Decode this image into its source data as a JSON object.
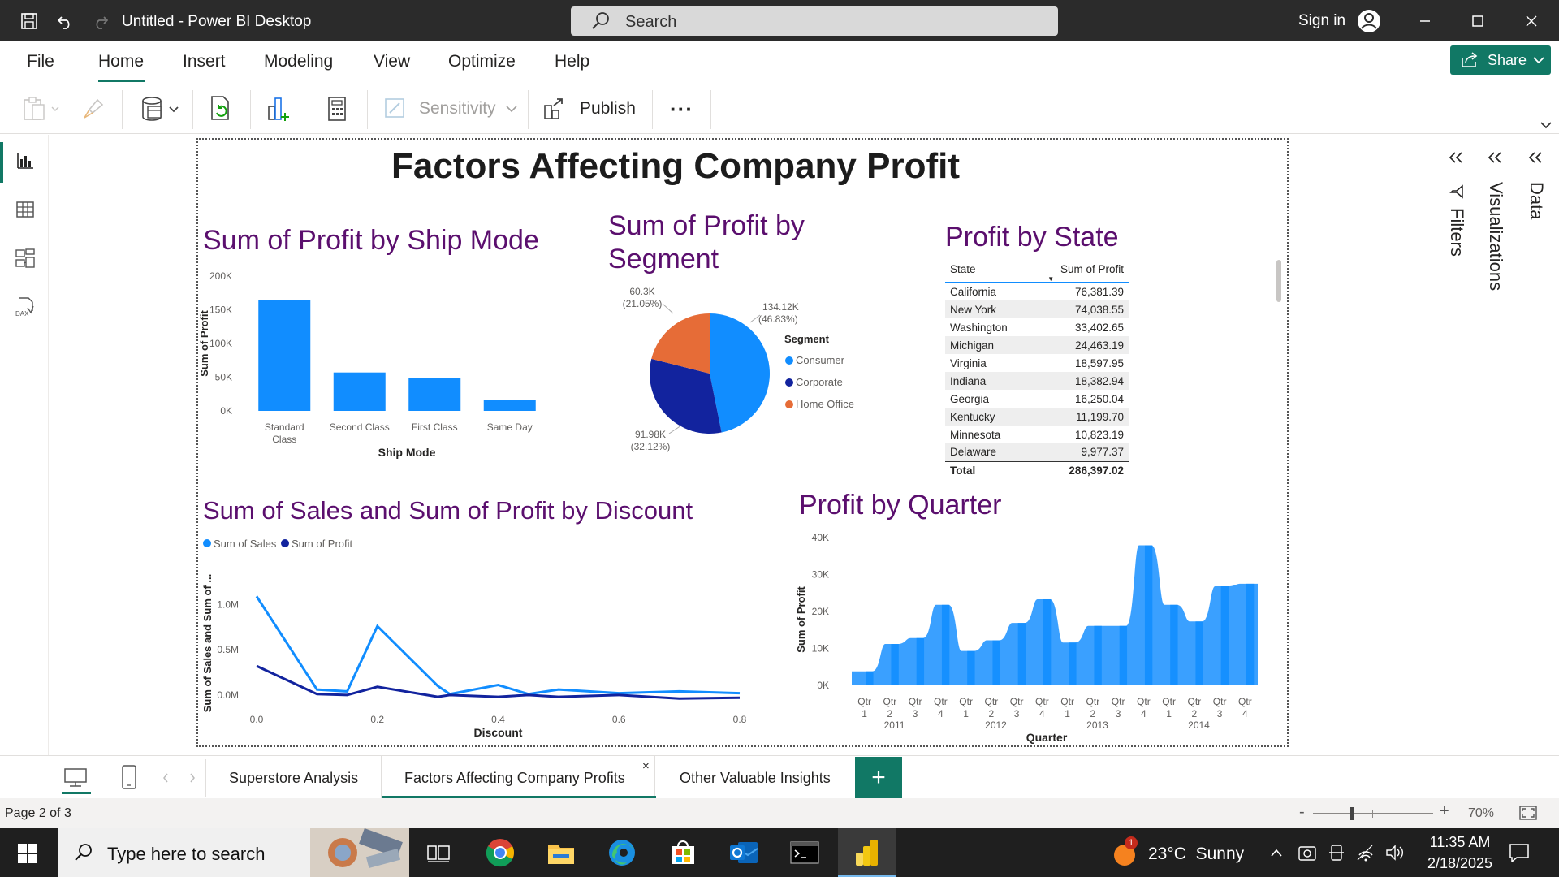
{
  "titlebar": {
    "title": "Untitled - Power BI Desktop",
    "search_placeholder": "Search",
    "signin": "Sign in"
  },
  "menu": {
    "items": [
      "File",
      "Home",
      "Insert",
      "Modeling",
      "View",
      "Optimize",
      "Help"
    ],
    "active": "Home",
    "share": "Share"
  },
  "toolbar": {
    "sensitivity": "Sensitivity",
    "publish": "Publish",
    "more": "···"
  },
  "report": {
    "title": "Factors Affecting Company Profit"
  },
  "visuals": {
    "ship_title": "Sum of Profit by Ship Mode",
    "segment_title": "Sum of Profit by Segment",
    "state_title": "Profit by State",
    "discount_title": "Sum of Sales and Sum of Profit by Discount",
    "quarter_title": "Profit by Quarter"
  },
  "state_table": {
    "headers": [
      "State",
      "Sum of Profit"
    ],
    "rows": [
      [
        "California",
        "76,381.39"
      ],
      [
        "New York",
        "74,038.55"
      ],
      [
        "Washington",
        "33,402.65"
      ],
      [
        "Michigan",
        "24,463.19"
      ],
      [
        "Virginia",
        "18,597.95"
      ],
      [
        "Indiana",
        "18,382.94"
      ],
      [
        "Georgia",
        "16,250.04"
      ],
      [
        "Kentucky",
        "11,199.70"
      ],
      [
        "Minnesota",
        "10,823.19"
      ],
      [
        "Delaware",
        "9,977.37"
      ]
    ],
    "total_label": "Total",
    "total_value": "286,397.02"
  },
  "chart_data": [
    {
      "type": "bar",
      "title": "Sum of Profit by Ship Mode",
      "xlabel": "Ship Mode",
      "ylabel": "Sum of Profit",
      "categories": [
        "Standard Class",
        "Second Class",
        "First Class",
        "Same Day"
      ],
      "values": [
        164000,
        57000,
        49000,
        15900
      ],
      "ylim": [
        0,
        200000
      ],
      "yticks": [
        "0K",
        "50K",
        "100K",
        "150K",
        "200K"
      ],
      "color": "#118dff"
    },
    {
      "type": "pie",
      "title": "Sum of Profit by Segment",
      "legend_title": "Segment",
      "categories": [
        "Consumer",
        "Corporate",
        "Home Office"
      ],
      "values": [
        134.12,
        91.98,
        60.3
      ],
      "value_labels": [
        "134.12K",
        "91.98K",
        "60.3K"
      ],
      "pct_labels": [
        "(46.83%)",
        "(32.12%)",
        "(21.05%)"
      ],
      "colors": [
        "#118dff",
        "#12239e",
        "#e66c37"
      ]
    },
    {
      "type": "line",
      "title": "Sum of Sales and Sum of Profit by Discount",
      "xlabel": "Discount",
      "ylabel": "Sum of Sales and Sum of ...",
      "x": [
        0.0,
        0.1,
        0.15,
        0.2,
        0.3,
        0.32,
        0.4,
        0.45,
        0.5,
        0.6,
        0.7,
        0.8
      ],
      "series": [
        {
          "name": "Sum of Sales",
          "color": "#118dff",
          "values": [
            1.09,
            0.06,
            0.04,
            0.76,
            0.1,
            0.01,
            0.11,
            0.01,
            0.06,
            0.02,
            0.04,
            0.02
          ]
        },
        {
          "name": "Sum of Profit",
          "color": "#12239e",
          "values": [
            0.32,
            0.01,
            0.0,
            0.09,
            -0.02,
            0.0,
            -0.02,
            0.0,
            -0.02,
            0.0,
            -0.04,
            -0.03
          ]
        }
      ],
      "ylim": [
        -0.1,
        1.2
      ],
      "yticks": [
        "0.0M",
        "0.5M",
        "1.0M"
      ],
      "xticks": [
        "0.0",
        "0.2",
        "0.4",
        "0.6",
        "0.8"
      ]
    },
    {
      "type": "area",
      "title": "Profit by Quarter",
      "xlabel": "Quarter",
      "ylabel": "Sum of Profit",
      "quarters": [
        "Qtr 1",
        "Qtr 2",
        "Qtr 3",
        "Qtr 4",
        "Qtr 1",
        "Qtr 2",
        "Qtr 3",
        "Qtr 4",
        "Qtr 1",
        "Qtr 2",
        "Qtr 3",
        "Qtr 4",
        "Qtr 1",
        "Qtr 2",
        "Qtr 3",
        "Qtr 4"
      ],
      "years": [
        "2011",
        "2012",
        "2013",
        "2014"
      ],
      "values": [
        3800,
        11200,
        12800,
        21800,
        9300,
        12200,
        16900,
        23300,
        11600,
        16100,
        16100,
        37900,
        21800,
        17300,
        26800,
        27500
      ],
      "ylim": [
        0,
        40000
      ],
      "yticks": [
        "0K",
        "10K",
        "20K",
        "30K",
        "40K"
      ],
      "color": "#118dff"
    }
  ],
  "side_panels": [
    "Filters",
    "Visualizations",
    "Data"
  ],
  "pages": {
    "tabs": [
      "Superstore Analysis",
      "Factors Affecting Company Profits",
      "Other Valuable Insights"
    ],
    "active": 1,
    "add": "+"
  },
  "status": {
    "page": "Page 2 of 3",
    "zoom": "70%"
  },
  "taskbar": {
    "search_placeholder": "Type here to search",
    "weather": "23°C  Sunny",
    "weather_badge": "1",
    "time": "11:35 AM",
    "date": "2/18/2025"
  }
}
